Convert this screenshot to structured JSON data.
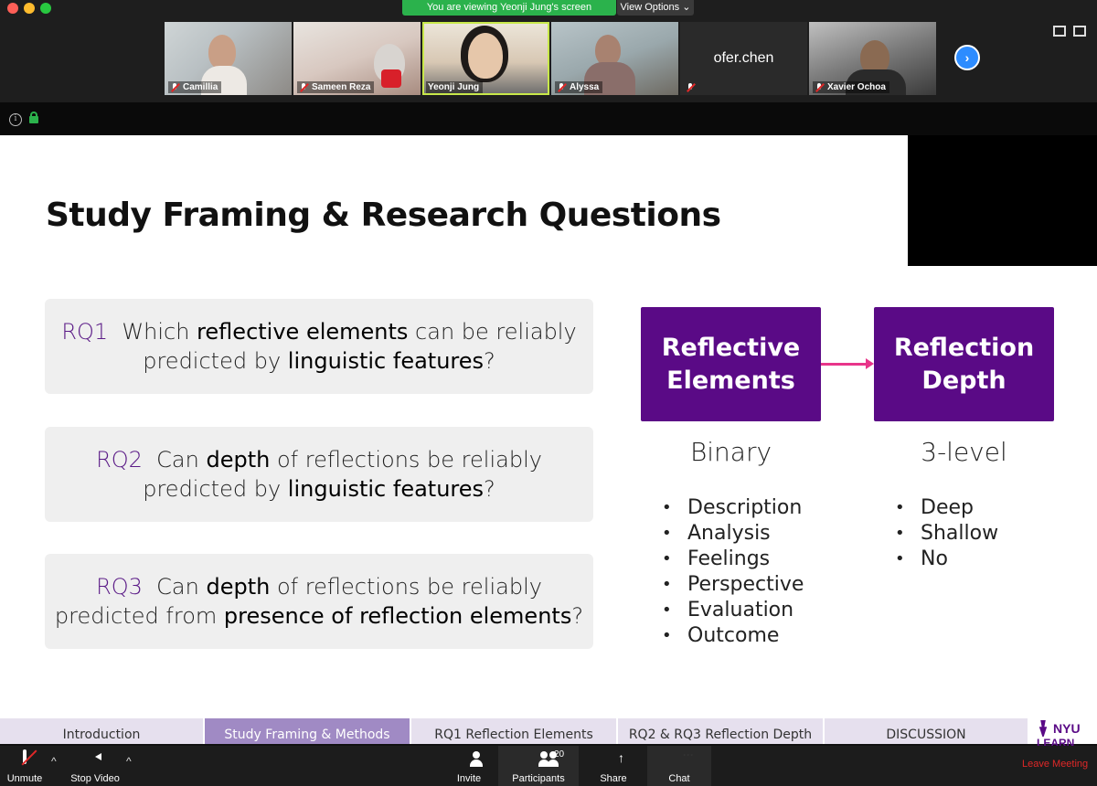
{
  "window": {
    "banner": "You are viewing Yeonji Jung's screen",
    "view_options": "View Options"
  },
  "participants_strip": [
    {
      "name": "Camillia",
      "muted": true,
      "video": true
    },
    {
      "name": "Sameen Reza",
      "muted": true,
      "video": true
    },
    {
      "name": "Yeonji Jung",
      "muted": false,
      "video": true,
      "active": true
    },
    {
      "name": "Alyssa",
      "muted": true,
      "video": true
    },
    {
      "name": "ofer.chen",
      "muted": true,
      "video": false
    },
    {
      "name": "Xavier Ochoa",
      "muted": true,
      "video": true
    }
  ],
  "icons": {
    "next": "chevron-right-icon",
    "info": "info-icon",
    "lock": "lock-icon"
  },
  "slide": {
    "title": "Study Framing & Research Questions",
    "rq1": {
      "id": "RQ1",
      "p1": "Which",
      "b1": "reflective elements",
      "p2": "can be reliably predicted by",
      "b2": "linguistic features",
      "p3": "?"
    },
    "rq2": {
      "id": "RQ2",
      "p1": "Can",
      "b1": "depth",
      "p2": "of reflections be reliably predicted by",
      "b2": "linguistic features",
      "p3": "?"
    },
    "rq3": {
      "id": "RQ3",
      "p1": "Can",
      "b1": "depth",
      "p2": "of reflections be reliably predicted from",
      "b2": "presence of reflection elements",
      "p3": "?"
    },
    "box_left": {
      "line1": "Reflective",
      "line2": "Elements"
    },
    "box_right": {
      "line1": "Reflection",
      "line2": "Depth"
    },
    "label_left": "Binary",
    "label_right": "3-level",
    "bullets_left": [
      "Description",
      "Analysis",
      "Feelings",
      "Perspective",
      "Evaluation",
      "Outcome"
    ],
    "bullets_right": [
      "Deep",
      "Shallow",
      "No"
    ],
    "colors": {
      "purple": "#5a0a86",
      "rq_label": "#5b1b87",
      "arrow": "#e8358a"
    }
  },
  "slide_nav": {
    "tabs": [
      "Introduction",
      "Study Framing & Methods",
      "RQ1 Reflection Elements",
      "RQ2 & RQ3 Reflection Depth",
      "DISCUSSION"
    ],
    "active_index": 1,
    "logo_line1": "NYU",
    "logo_line2": "LEARN"
  },
  "toolbar": {
    "unmute": "Unmute",
    "stop_video": "Stop Video",
    "invite": "Invite",
    "participants": "Participants",
    "participants_count": "20",
    "share": "Share",
    "chat": "Chat",
    "leave": "Leave Meeting"
  }
}
